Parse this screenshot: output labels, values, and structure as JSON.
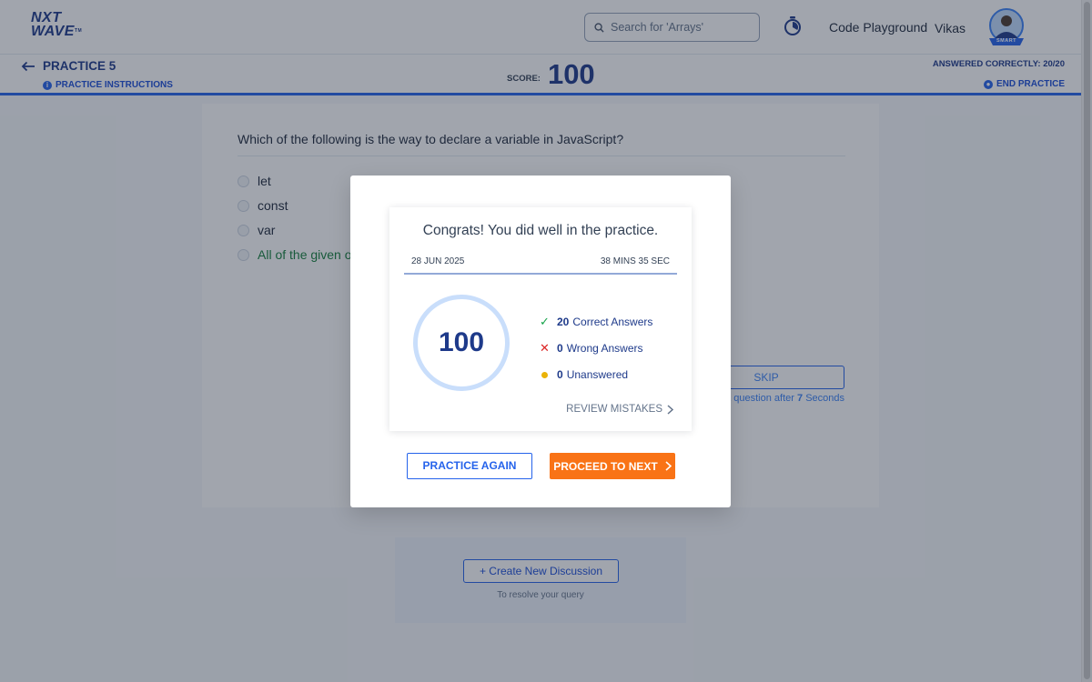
{
  "header": {
    "logo_line1": "NXT",
    "logo_line2": "WAVE",
    "logo_tm": "TM",
    "search_placeholder": "Search for 'Arrays'",
    "code_playground": "Code Playground",
    "user_name": "Vikas",
    "avatar_badge": "SMART"
  },
  "practice": {
    "title": "PRACTICE 5",
    "instructions": "PRACTICE INSTRUCTIONS",
    "score_label": "SCORE:",
    "score_value": "100",
    "answered_correctly": "ANSWERED CORRECTLY: 20/20",
    "end_practice": "END PRACTICE"
  },
  "question": {
    "text": "Which of the following is the way to declare a variable in JavaScript?",
    "options": [
      "let",
      "const",
      "var",
      "All of the given options"
    ],
    "skip_label": "SKIP",
    "next_note_prefix": "Next question after",
    "next_note_seconds": "7",
    "next_note_suffix": "Seconds"
  },
  "discussion": {
    "button": "+ Create New Discussion",
    "note": "To resolve your query"
  },
  "modal": {
    "title": "Congrats! You did well in the practice.",
    "date": "28 JUN 2025",
    "duration": "38 MINS 35 SEC",
    "score": "100",
    "correct_count": "20",
    "correct_label": "Correct Answers",
    "wrong_count": "0",
    "wrong_label": "Wrong Answers",
    "unanswered_count": "0",
    "unanswered_label": "Unanswered",
    "review_label": "REVIEW MISTAKES",
    "practice_again": "PRACTICE AGAIN",
    "proceed_next": "PROCEED TO NEXT"
  },
  "colors": {
    "brand_blue": "#1e3a8a",
    "accent_blue": "#2563eb",
    "orange": "#f97316",
    "success": "#16a34a",
    "error": "#dc2626",
    "warning": "#eab308"
  }
}
